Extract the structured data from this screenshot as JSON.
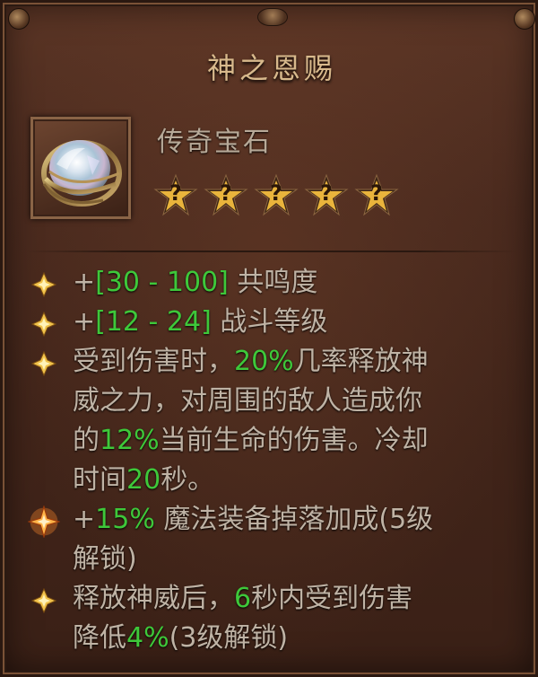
{
  "tooltip": {
    "title": "神之恩赐",
    "item_type": "传奇宝石",
    "sockets": [
      {
        "label": "?"
      },
      {
        "label": "?"
      },
      {
        "label": "?"
      },
      {
        "label": "?"
      },
      {
        "label": "?"
      }
    ],
    "affixes": [
      {
        "lines": [
          [
            {
              "t": "+",
              "c": ""
            },
            {
              "t": "[30 - 100]",
              "c": "g"
            },
            {
              "t": " 共鸣度",
              "c": ""
            }
          ]
        ]
      },
      {
        "lines": [
          [
            {
              "t": "+",
              "c": ""
            },
            {
              "t": "[12 - 24]",
              "c": "g"
            },
            {
              "t": " 战斗等级",
              "c": ""
            }
          ]
        ]
      },
      {
        "lines": [
          [
            {
              "t": "受到伤害时，",
              "c": ""
            },
            {
              "t": "20%",
              "c": "g"
            },
            {
              "t": "几率释放神",
              "c": ""
            }
          ],
          [
            {
              "t": "威之力，对周围的敌人造成你",
              "c": ""
            }
          ],
          [
            {
              "t": "的",
              "c": ""
            },
            {
              "t": "12%",
              "c": "g"
            },
            {
              "t": "当前生命的伤害。冷却",
              "c": ""
            }
          ],
          [
            {
              "t": "时间",
              "c": ""
            },
            {
              "t": "20",
              "c": "g"
            },
            {
              "t": "秒。",
              "c": ""
            }
          ]
        ]
      },
      {
        "lines": [
          [
            {
              "t": "+",
              "c": ""
            },
            {
              "t": "15%",
              "c": "g"
            },
            {
              "t": " 魔法装备掉落加成(5级",
              "c": ""
            }
          ],
          [
            {
              "t": "解锁)",
              "c": ""
            }
          ]
        ]
      },
      {
        "lines": [
          [
            {
              "t": "释放神威后，",
              "c": ""
            },
            {
              "t": "6",
              "c": "g"
            },
            {
              "t": "秒内受到伤害",
              "c": ""
            }
          ],
          [
            {
              "t": "降低",
              "c": ""
            },
            {
              "t": "4%",
              "c": "g"
            },
            {
              "t": "(3级解锁)",
              "c": ""
            }
          ]
        ]
      }
    ]
  },
  "icons": {
    "item_icon": "legendary-gem-icon",
    "socket_icon": "unknown-star-socket-icon",
    "bullet_icon": "gold-diamond-bullet-icon",
    "special_bullet_icon": "glowing-star-bullet-icon"
  },
  "colors": {
    "value_green": "#3ec83a",
    "text_main": "#bfb3a5",
    "title_gold": "#d8b98c"
  }
}
